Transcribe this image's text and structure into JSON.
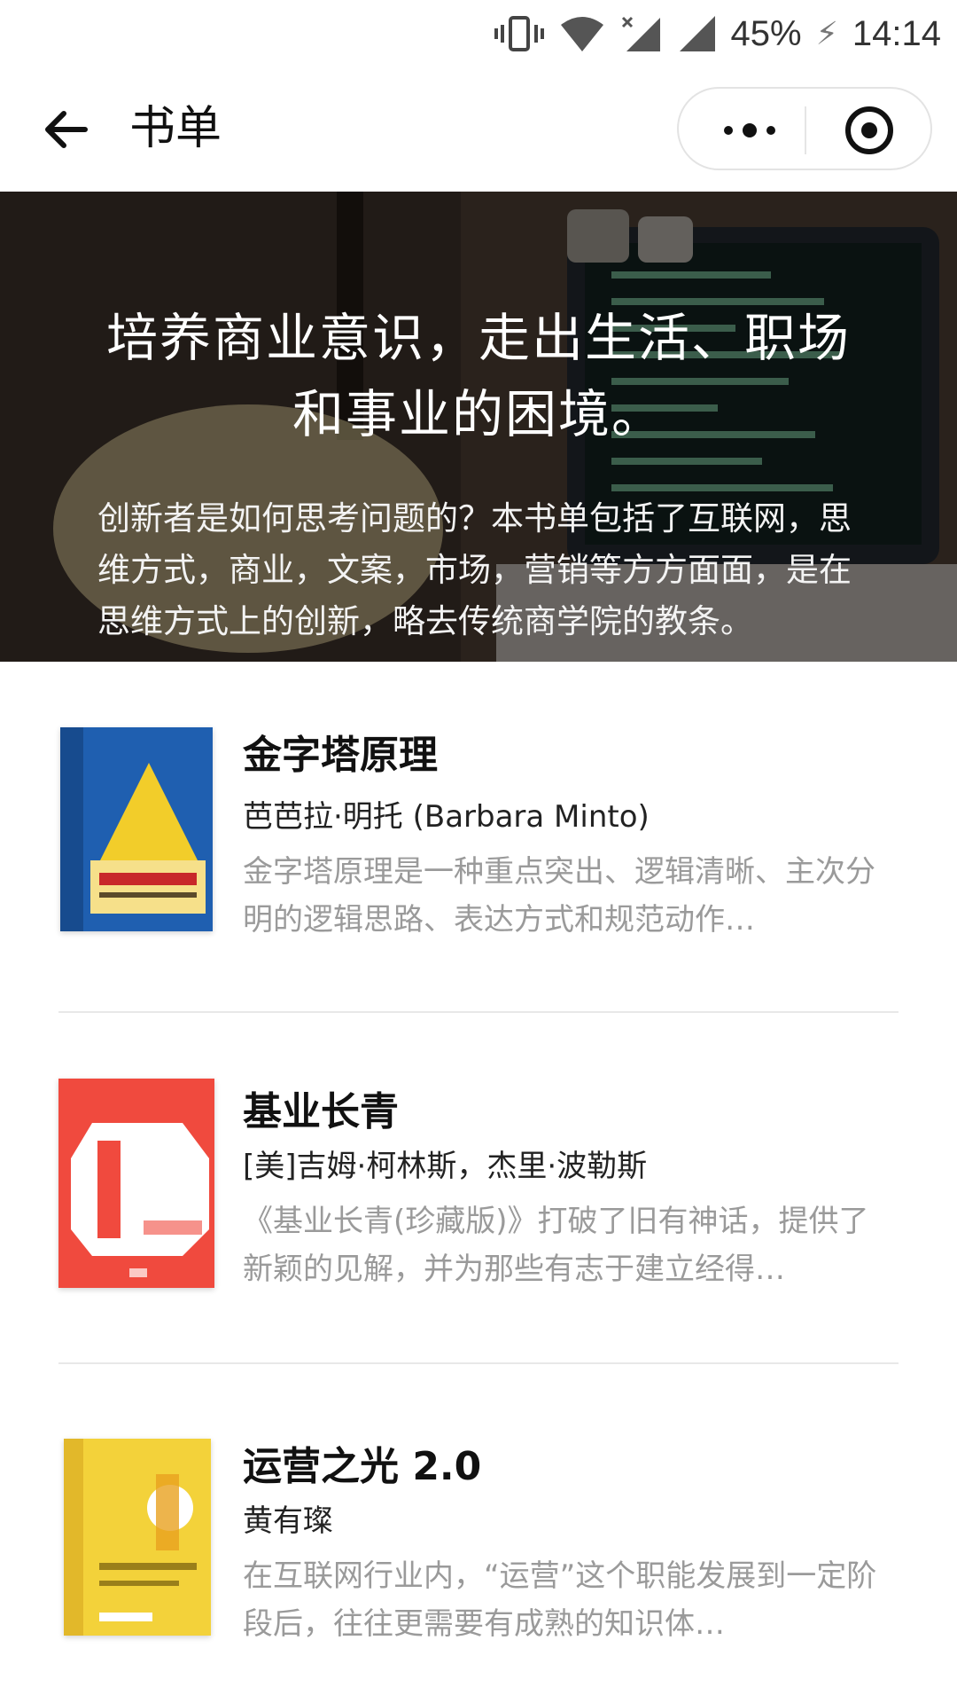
{
  "status_bar": {
    "battery": "45%",
    "time": "14:14",
    "icons": [
      "vibrate-icon",
      "wifi-icon",
      "no-signal-icon",
      "signal-icon",
      "charging-icon"
    ]
  },
  "nav": {
    "title": "书单",
    "back_icon": "arrow-left-icon",
    "more_icon": "more-dots-icon",
    "close_icon": "target-icon"
  },
  "banner": {
    "title_line1": "培养商业意识，走出生活、职场",
    "title_line2": "和事业的困境。",
    "desc": "创新者是如何思考问题的？本书单包括了互联网，思维方式，商业，文案，市场，营销等方方面面，是在思维方式上的创新，略去传统商学院的教条。"
  },
  "books": [
    {
      "title": "金字塔原理",
      "author": "芭芭拉·明托 (Barbara Minto)",
      "desc": "金字塔原理是一种重点突出、逻辑清晰、主次分明的逻辑思路、表达方式和规范动作…",
      "cover_color": "#1f5fb0"
    },
    {
      "title": "基业长青",
      "author": "[美]吉姆·柯林斯，杰里·波勒斯",
      "desc": "《基业长青(珍藏版)》打破了旧有神话，提供了新颖的见解，并为那些有志于建立经得…",
      "cover_color": "#f04a3e"
    },
    {
      "title": "运营之光 2.0",
      "author": "黄有璨",
      "desc": "在互联网行业内，“运营”这个职能发展到一定阶段后，往往更需要有成熟的知识体…",
      "cover_color": "#f3d23a"
    }
  ]
}
